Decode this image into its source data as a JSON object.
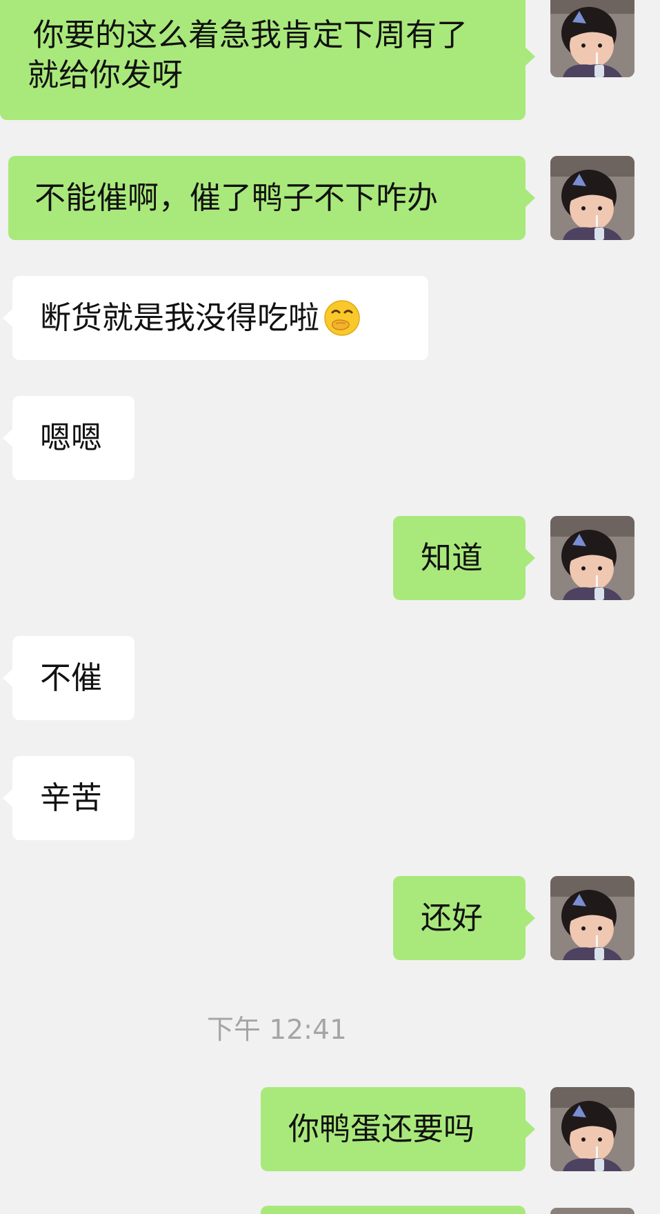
{
  "messages": [
    {
      "side": "out",
      "text": "你要的这么着急我肯定下周有了就给你发呀"
    },
    {
      "side": "out",
      "text": "不能催啊，催了鸭子不下咋办"
    },
    {
      "side": "in",
      "text": "断货就是我没得吃啦"
    },
    {
      "side": "in",
      "text": "嗯嗯"
    },
    {
      "side": "out",
      "text": "知道"
    },
    {
      "side": "in",
      "text": "不催"
    },
    {
      "side": "in",
      "text": "辛苦"
    },
    {
      "side": "out",
      "text": "还好"
    },
    {
      "side": "out",
      "text": "你鸭蛋还要吗"
    }
  ],
  "timestamp": "下午 12:41",
  "icons": {
    "emoji": "hand-over-mouth-emoji-icon",
    "avatar": "child-avatar-icon"
  },
  "colors": {
    "background": "#f1f1f1",
    "outgoing_bubble": "#a9e97b",
    "incoming_bubble": "#ffffff",
    "timestamp": "#a5a5a5"
  }
}
